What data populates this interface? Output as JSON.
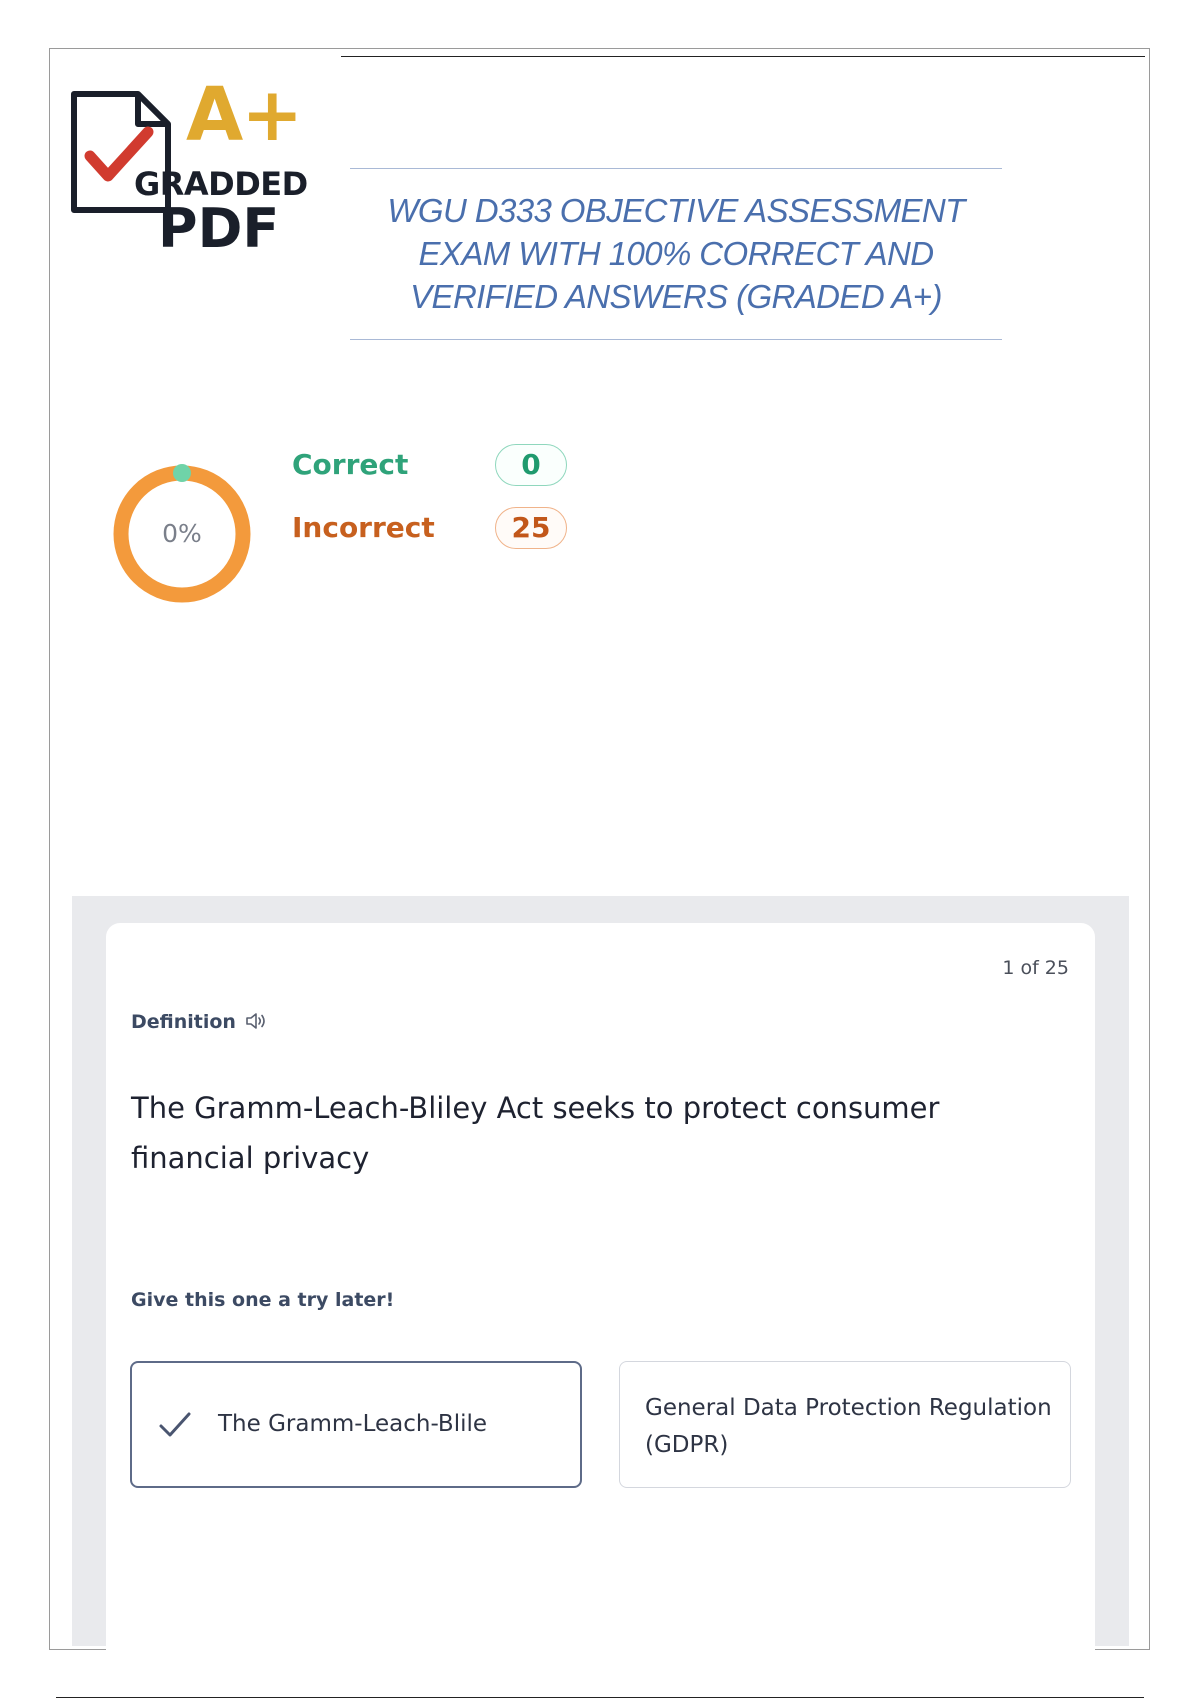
{
  "branding": {
    "logo_grade": "A+",
    "logo_line1": "GRADDED",
    "logo_line2": "PDF",
    "colors": {
      "grade": "#e0a92f",
      "check": "#d13b2f",
      "ink": "#1a1f2a"
    }
  },
  "document": {
    "title": "WGU D333 OBJECTIVE ASSESSMENT EXAM WITH 100% CORRECT AND VERIFIED ANSWERS (GRADED A+)",
    "title_color": "#4a6fad"
  },
  "score": {
    "percent_label": "0%",
    "percent": 0,
    "correct_label": "Correct",
    "correct_count": "0",
    "incorrect_label": "Incorrect",
    "incorrect_count": "25",
    "colors": {
      "correct": "#2fa37a",
      "incorrect": "#c7601e",
      "ring": "#f39a3c",
      "marker": "#6fd3a8"
    }
  },
  "flashcard": {
    "progress": "1 of 25",
    "term_type": "Definition",
    "audio_icon": "speaker-icon",
    "definition": "The Gramm-Leach-Bliley Act seeks to protect consumer financial privacy",
    "try_later": "Give this one a try later!",
    "answers": [
      {
        "text": "The Gramm-Leach-Blile",
        "selected": true,
        "icon": "check-icon"
      },
      {
        "text": "General Data Protection Regulation (GDPR)",
        "selected": false
      }
    ]
  }
}
